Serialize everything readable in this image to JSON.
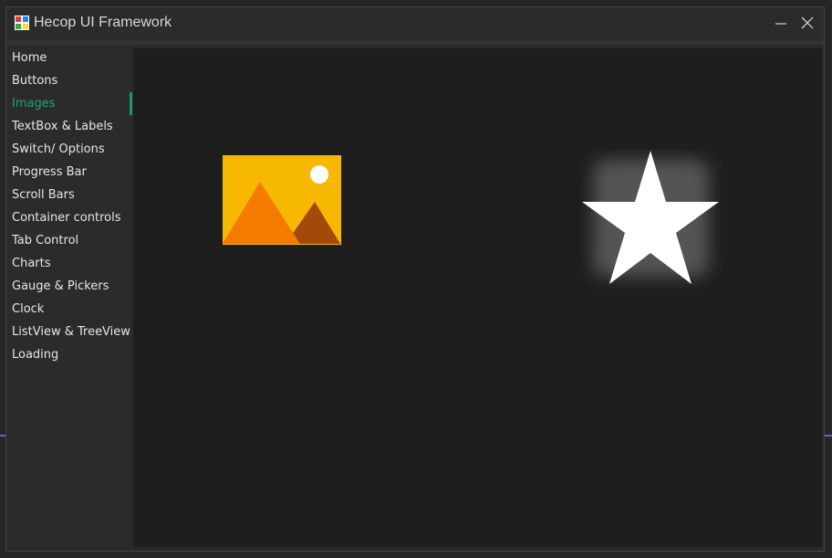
{
  "window": {
    "title": "Hecop UI Framework",
    "icon": "app-logo-icon"
  },
  "controls": {
    "minimize_icon": "minimize-icon",
    "close_icon": "close-icon"
  },
  "sidebar": {
    "active_index": 2,
    "accent_color": "#15996f",
    "items": [
      {
        "label": "Home"
      },
      {
        "label": "Buttons"
      },
      {
        "label": "Images"
      },
      {
        "label": "TextBox & Labels"
      },
      {
        "label": "Switch/ Options"
      },
      {
        "label": "Progress Bar"
      },
      {
        "label": "Scroll Bars"
      },
      {
        "label": "Container controls"
      },
      {
        "label": "Tab Control"
      },
      {
        "label": "Charts"
      },
      {
        "label": "Gauge & Pickers"
      },
      {
        "label": "Clock"
      },
      {
        "label": "ListView & TreeView"
      },
      {
        "label": "Loading"
      }
    ]
  },
  "content": {
    "images": [
      {
        "icon": "picture-icon",
        "colors": {
          "frame": "#f6b800",
          "mountain_front": "#f47a00",
          "mountain_back": "#a34a0a",
          "sun": "#ffffff"
        }
      },
      {
        "icon": "star-icon",
        "colors": {
          "fill": "#ffffff"
        }
      }
    ]
  }
}
